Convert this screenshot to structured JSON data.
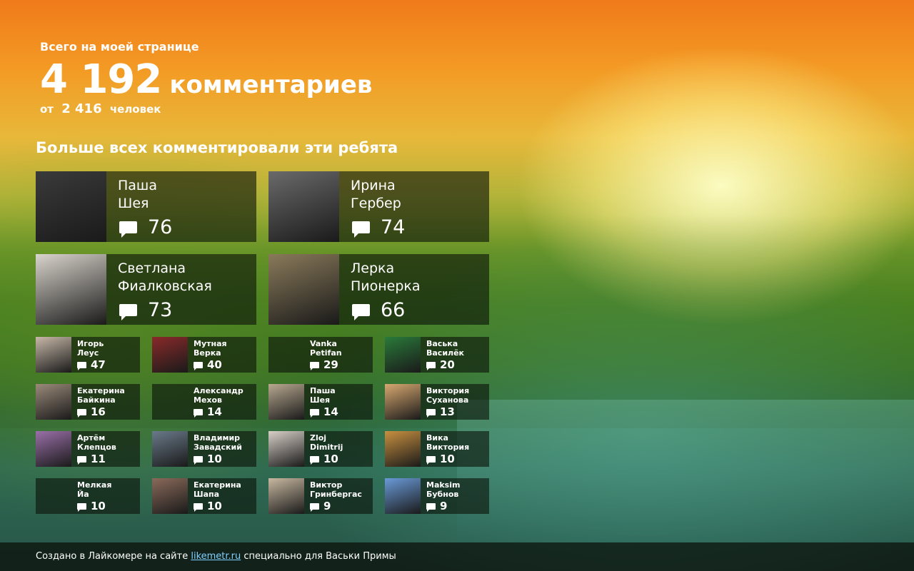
{
  "header": {
    "subtitle": "Всего на моей странице",
    "total_count": "4 192",
    "total_label": "комментариев",
    "from_label": "от",
    "people_count": "2 416",
    "people_label": "человек"
  },
  "section_title": "Больше всех комментировали эти ребята",
  "top_commenters": [
    {
      "first": "Паша",
      "last": "Шея",
      "count": "76",
      "photo_color": "#3a3a3a"
    },
    {
      "first": "Ирина",
      "last": "Гербер",
      "count": "74",
      "photo_color": "#6a6a6a"
    },
    {
      "first": "Светлана",
      "last": "Фиалковская",
      "count": "73",
      "photo_color": "#d9d4cc"
    },
    {
      "first": "Лерка",
      "last": "Пионерка",
      "count": "66",
      "photo_color": "#8a7a5a"
    }
  ],
  "commenters": [
    {
      "first": "Игорь",
      "last": "Леус",
      "count": "47",
      "photo_color": "#c7b8a8"
    },
    {
      "first": "Мутная",
      "last": "Верка",
      "count": "40",
      "photo_color": "#8a2a2a"
    },
    {
      "first": "Vanka",
      "last": "Petifan",
      "count": "29",
      "photo_color": ""
    },
    {
      "first": "Васька",
      "last": "Василёк",
      "count": "20",
      "photo_color": "#2a7a3a"
    },
    {
      "first": "Екатерина",
      "last": "Байкина",
      "count": "16",
      "photo_color": "#9a8a7a"
    },
    {
      "first": "Александр",
      "last": "Мехов",
      "count": "14",
      "photo_color": ""
    },
    {
      "first": "Паша",
      "last": "Шея",
      "count": "14",
      "photo_color": "#b8a890"
    },
    {
      "first": "Виктория",
      "last": "Суханова",
      "count": "13",
      "photo_color": "#d8a870"
    },
    {
      "first": "Артём",
      "last": "Клепцов",
      "count": "11",
      "photo_color": "#9a70a8"
    },
    {
      "first": "Владимир",
      "last": "Завадский",
      "count": "10",
      "photo_color": "#6a7a8a"
    },
    {
      "first": "Zloj",
      "last": "Dimitrij",
      "count": "10",
      "photo_color": "#d8d0c8"
    },
    {
      "first": "Вика",
      "last": "Виктория",
      "count": "10",
      "photo_color": "#c89040"
    },
    {
      "first": "Мелкая",
      "last": "Йа",
      "count": "10",
      "photo_color": ""
    },
    {
      "first": "Екатерина",
      "last": "Шапа",
      "count": "10",
      "photo_color": "#8a6a5a"
    },
    {
      "first": "Виктор",
      "last": "Гринбергас",
      "count": "9",
      "photo_color": "#c8b8a0"
    },
    {
      "first": "Maksim",
      "last": "Бубнов",
      "count": "9",
      "photo_color": "#6a9ad8"
    }
  ],
  "footer": {
    "prefix": "Создано в Лайкомере на сайте",
    "link": "likemetr.ru",
    "suffix": "специально для",
    "owner": "Васьки Примы"
  },
  "colors": {
    "card_bg": "rgba(12,20,10,0.62)",
    "link": "#7fd0ff",
    "text": "#ffffff"
  }
}
